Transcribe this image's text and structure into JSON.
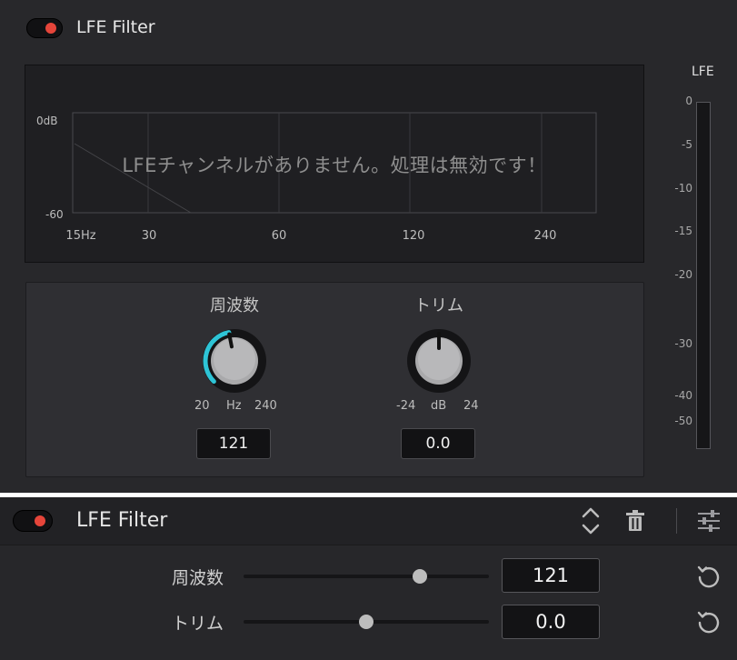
{
  "top": {
    "title": "LFE Filter",
    "toggle_color": "#e5453a",
    "graph": {
      "db_top": "0dB",
      "db_bottom": "-60",
      "freq_labels": [
        "15Hz",
        "30",
        "60",
        "120",
        "240"
      ],
      "message": "LFEチャンネルがありません。処理は無効です！"
    },
    "knobs": {
      "frequency": {
        "title": "周波数",
        "min": "20",
        "unit": "Hz",
        "max": "240",
        "value": "121",
        "accent": "#2ec4d6"
      },
      "trim": {
        "title": "トリム",
        "min": "-24",
        "unit": "dB",
        "max": "24",
        "value": "0.0"
      }
    },
    "meter": {
      "title": "LFE",
      "ticks": [
        "0",
        "-5",
        "-10",
        "-15",
        "-20",
        "-30",
        "-40",
        "-50"
      ]
    }
  },
  "bottom": {
    "title": "LFE Filter",
    "icons": [
      "chevron-updown-icon",
      "trash-icon",
      "sliders-icon"
    ],
    "params": [
      {
        "label": "周波数",
        "value": "121",
        "slider_fraction": 0.72
      },
      {
        "label": "トリム",
        "value": "0.0",
        "slider_fraction": 0.5
      }
    ]
  }
}
